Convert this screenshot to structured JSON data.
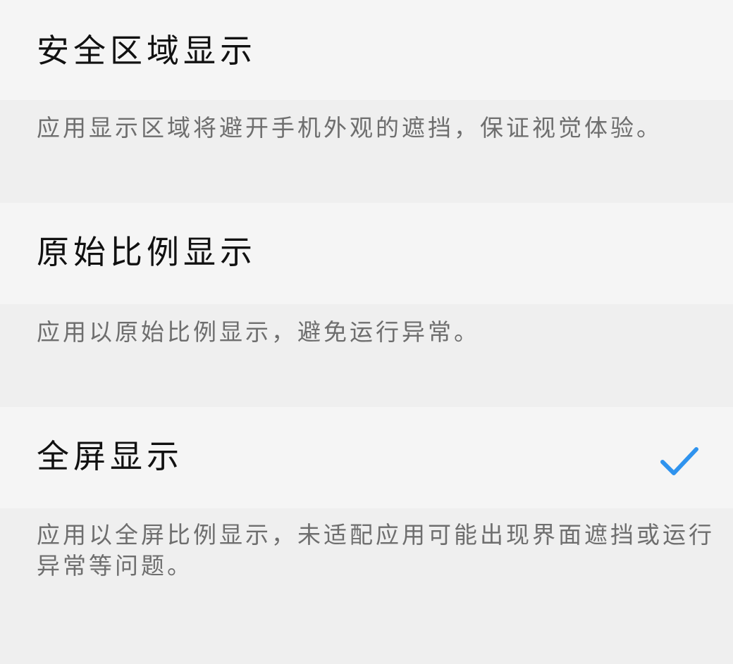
{
  "options": [
    {
      "title": "安全区域显示",
      "description": "应用显示区域将避开手机外观的遮挡，保证视觉体验。",
      "selected": false
    },
    {
      "title": "原始比例显示",
      "description": "应用以原始比例显示，避免运行异常。",
      "selected": false
    },
    {
      "title": "全屏显示",
      "description": "应用以全屏比例显示，未适配应用可能出现界面遮挡或运行异常等问题。",
      "selected": true
    }
  ],
  "colors": {
    "accent": "#2f93ee",
    "title_text": "#111111",
    "desc_text": "#6e6e6e",
    "title_bg": "#f5f5f5",
    "desc_bg": "#efefef"
  },
  "icons": {
    "selected": "checkmark-icon"
  }
}
